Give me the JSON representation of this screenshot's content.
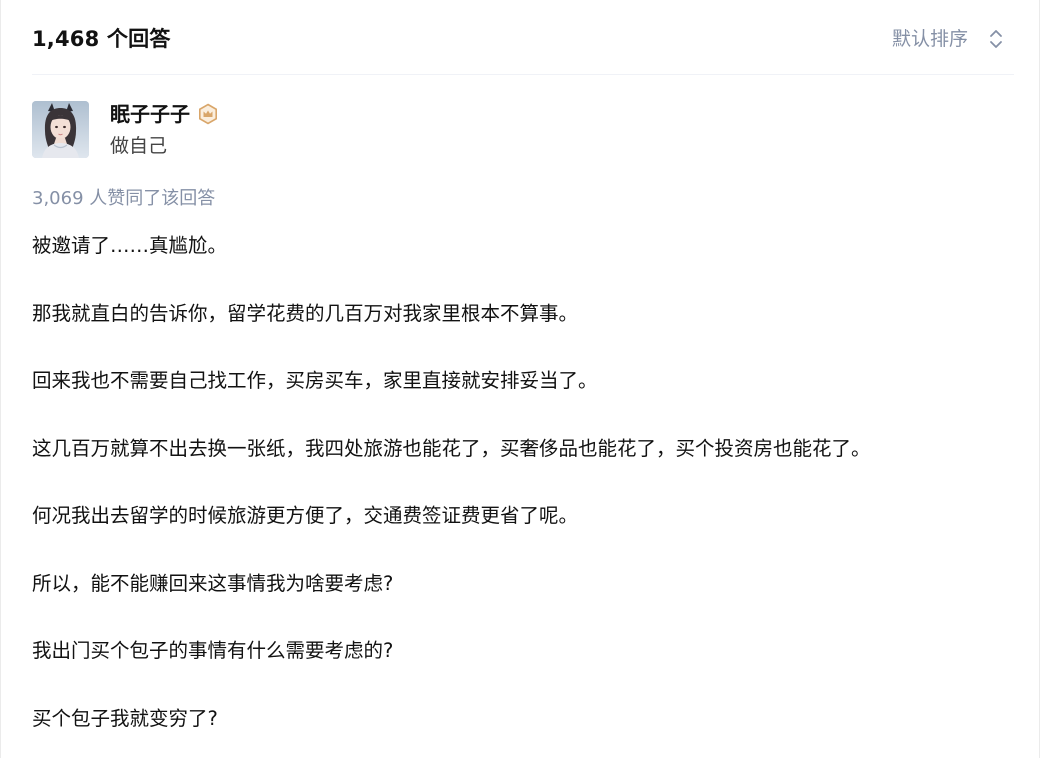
{
  "header": {
    "answer_count": "1,468 个回答",
    "sort_label": "默认排序",
    "sort_icon": "sort-updown-icon"
  },
  "author": {
    "name": "眠子子子",
    "bio": "做自己",
    "badge_icon": "crown-badge-icon",
    "badge_color": "#d9a66a"
  },
  "answer": {
    "votes_text": "3,069 人赞同了该回答",
    "paragraphs": [
      "被邀请了……真尴尬。",
      "那我就直白的告诉你，留学花费的几百万对我家里根本不算事。",
      "回来我也不需要自己找工作，买房买车，家里直接就安排妥当了。",
      "这几百万就算不出去换一张纸，我四处旅游也能花了，买奢侈品也能花了，买个投资房也能花了。",
      "何况我出去留学的时候旅游更方便了，交通费签证费更省了呢。",
      "所以，能不能赚回来这事情我为啥要考虑?",
      "我出门买个包子的事情有什么需要考虑的?",
      "买个包子我就变穷了?"
    ]
  },
  "colors": {
    "text_primary": "#121212",
    "text_secondary": "#8590a6",
    "divider": "#f0f2f7"
  }
}
